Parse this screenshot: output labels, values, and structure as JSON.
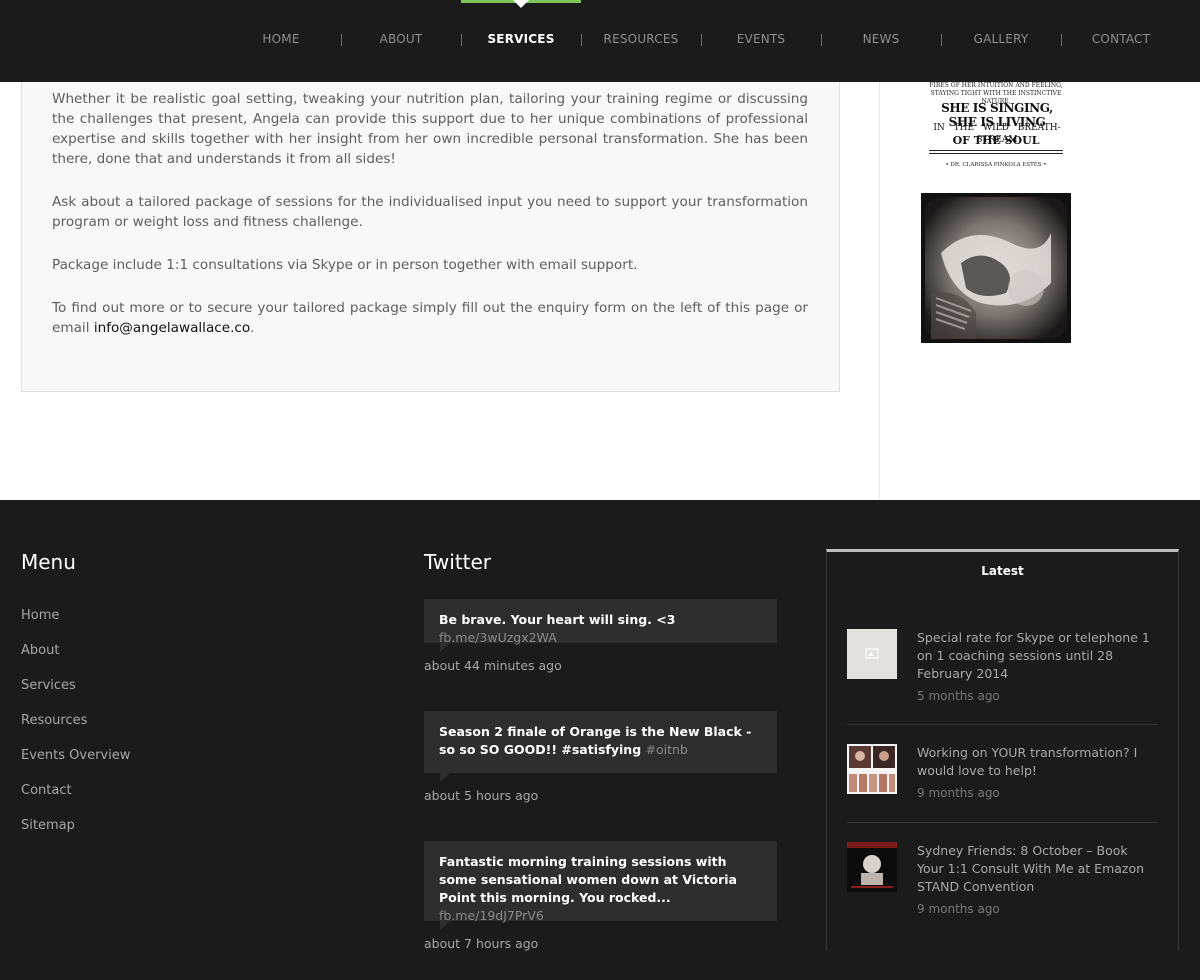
{
  "nav": {
    "items": [
      {
        "label": "HOME"
      },
      {
        "label": "ABOUT"
      },
      {
        "label": "SERVICES",
        "active": true
      },
      {
        "label": "RESOURCES"
      },
      {
        "label": "EVENTS"
      },
      {
        "label": "NEWS"
      },
      {
        "label": "GALLERY"
      },
      {
        "label": "CONTACT"
      }
    ],
    "active_color": "#7dc75a"
  },
  "content": {
    "paragraphs": [
      "Whether it be realistic goal setting, tweaking your nutrition plan, tailoring your training regime or discussing the challenges that present,   Angela can provide this support due to her unique combinations of professional expertise and skills together with her insight from her own incredible personal transformation. She has been there, done that and understands it from all sides!",
      "Ask about a tailored package of sessions for the individualised input you need to support your transformation program or weight loss and fitness challenge.",
      "Package include 1:1 consultations via Skype or in person together with email support."
    ],
    "last_paragraph_prefix": "To find out more or to secure your tailored package simply fill out the enquiry form on the left of this page or email ",
    "email_link": "info@angelawallace.co",
    "last_paragraph_suffix": "."
  },
  "sidebar": {
    "quote": {
      "line_top": "FIRES OF HER INTUITION AND FEELING, STAYING TIGHT WITH THE INSTINCTIVE NATURE,",
      "line_big": "SHE IS SINGING, SHE IS LIVING",
      "line_mid": "IN THE WILD BREATH-STREAM",
      "line_soul": "OF THE SOUL",
      "author": "• DR. CLARISSA PINKOLA ESTÉS •"
    }
  },
  "footer": {
    "menu": {
      "heading": "Menu",
      "items": [
        "Home",
        "About",
        "Services",
        "Resources",
        "Events Overview",
        "Contact",
        "Sitemap"
      ]
    },
    "twitter": {
      "heading": "Twitter",
      "tweets": [
        {
          "text": "Be brave. Your heart will sing. <3 ",
          "link": "fb.me/3wUzgx2WA",
          "time": "about 44 minutes ago"
        },
        {
          "text": "Season 2 finale of Orange is the New Black - so so SO GOOD!! #satisfying ",
          "link": "#oitnb",
          "time": "about 5 hours ago"
        },
        {
          "text": "Fantastic morning training sessions with some sensational women down at Victoria Point this morning. You rocked... ",
          "link": "fb.me/19dJ7PrV6",
          "time": "about 7 hours ago"
        }
      ]
    },
    "latest": {
      "heading": "Latest",
      "posts": [
        {
          "title": "Special rate for Skype or telephone 1 on 1 coaching sessions until 28 February 2014",
          "ago": "5 months ago"
        },
        {
          "title": "Working on YOUR transformation? I would love to help!",
          "ago": "9 months ago"
        },
        {
          "title": "Sydney Friends: 8 October – Book Your 1:1 Consult With Me at Emazon STAND Convention",
          "ago": "9 months ago"
        }
      ]
    }
  }
}
